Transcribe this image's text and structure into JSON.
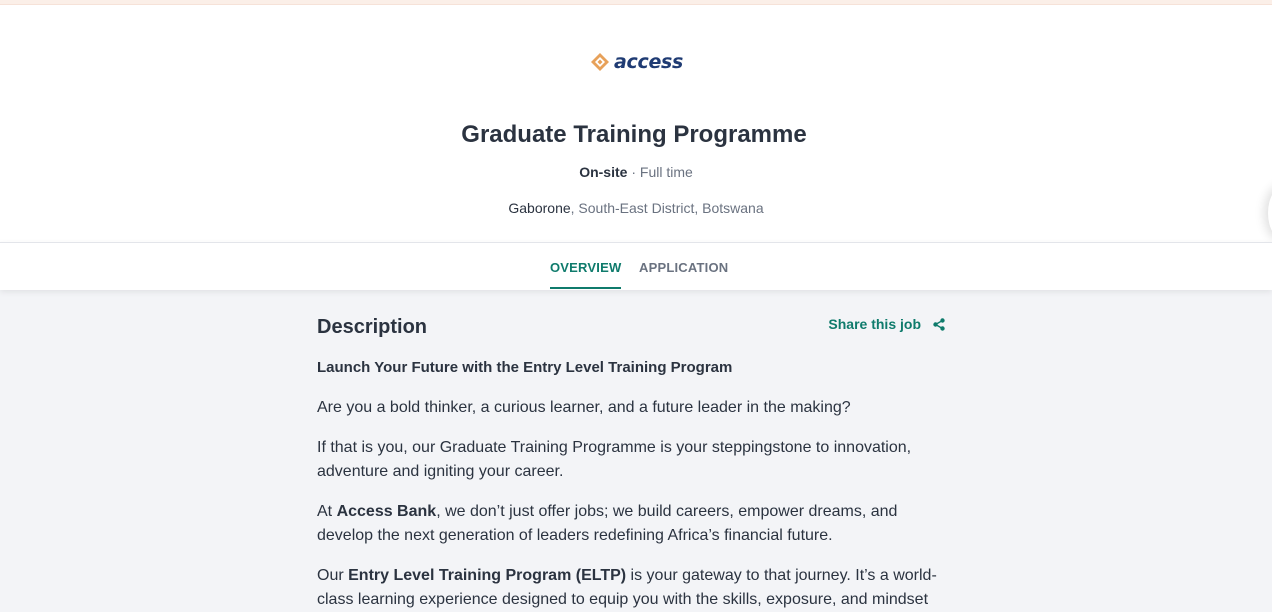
{
  "brand": {
    "logo_text": "access",
    "logo_accent": "#e7a15a",
    "logo_text_color": "#1f3b73"
  },
  "job": {
    "title": "Graduate Training Programme",
    "workplace": "On-site",
    "separator": " · ",
    "type": "Full time",
    "city": "Gaborone",
    "region": ", South-East District, Botswana"
  },
  "tabs": [
    {
      "label": "OVERVIEW",
      "active": true
    },
    {
      "label": "APPLICATION",
      "active": false
    }
  ],
  "description": {
    "heading": "Description",
    "share_label": "Share this job",
    "subheading": "Launch Your Future with the Entry Level Training Program",
    "p1": "Are you a bold thinker, a curious learner, and a future leader in the making?",
    "p2": "If that is you, our Graduate Training Programme is your steppingstone to innovation, adventure and igniting your career.",
    "p3_pre": "At ",
    "p3_bold": "Access Bank",
    "p3_post": ", we don’t just offer jobs; we build careers, empower dreams, and develop the next generation of leaders redefining Africa’s financial future.",
    "p4_pre": "Our ",
    "p4_bold": "Entry Level Training Program (ELTP)",
    "p4_post": " is your gateway to that journey. It’s a world-class learning experience designed to equip you with the skills, exposure, and mindset"
  },
  "colors": {
    "accent": "#0f7b6c",
    "background": "#f3f4f7",
    "text": "#2b3340",
    "muted": "#6a7280"
  }
}
